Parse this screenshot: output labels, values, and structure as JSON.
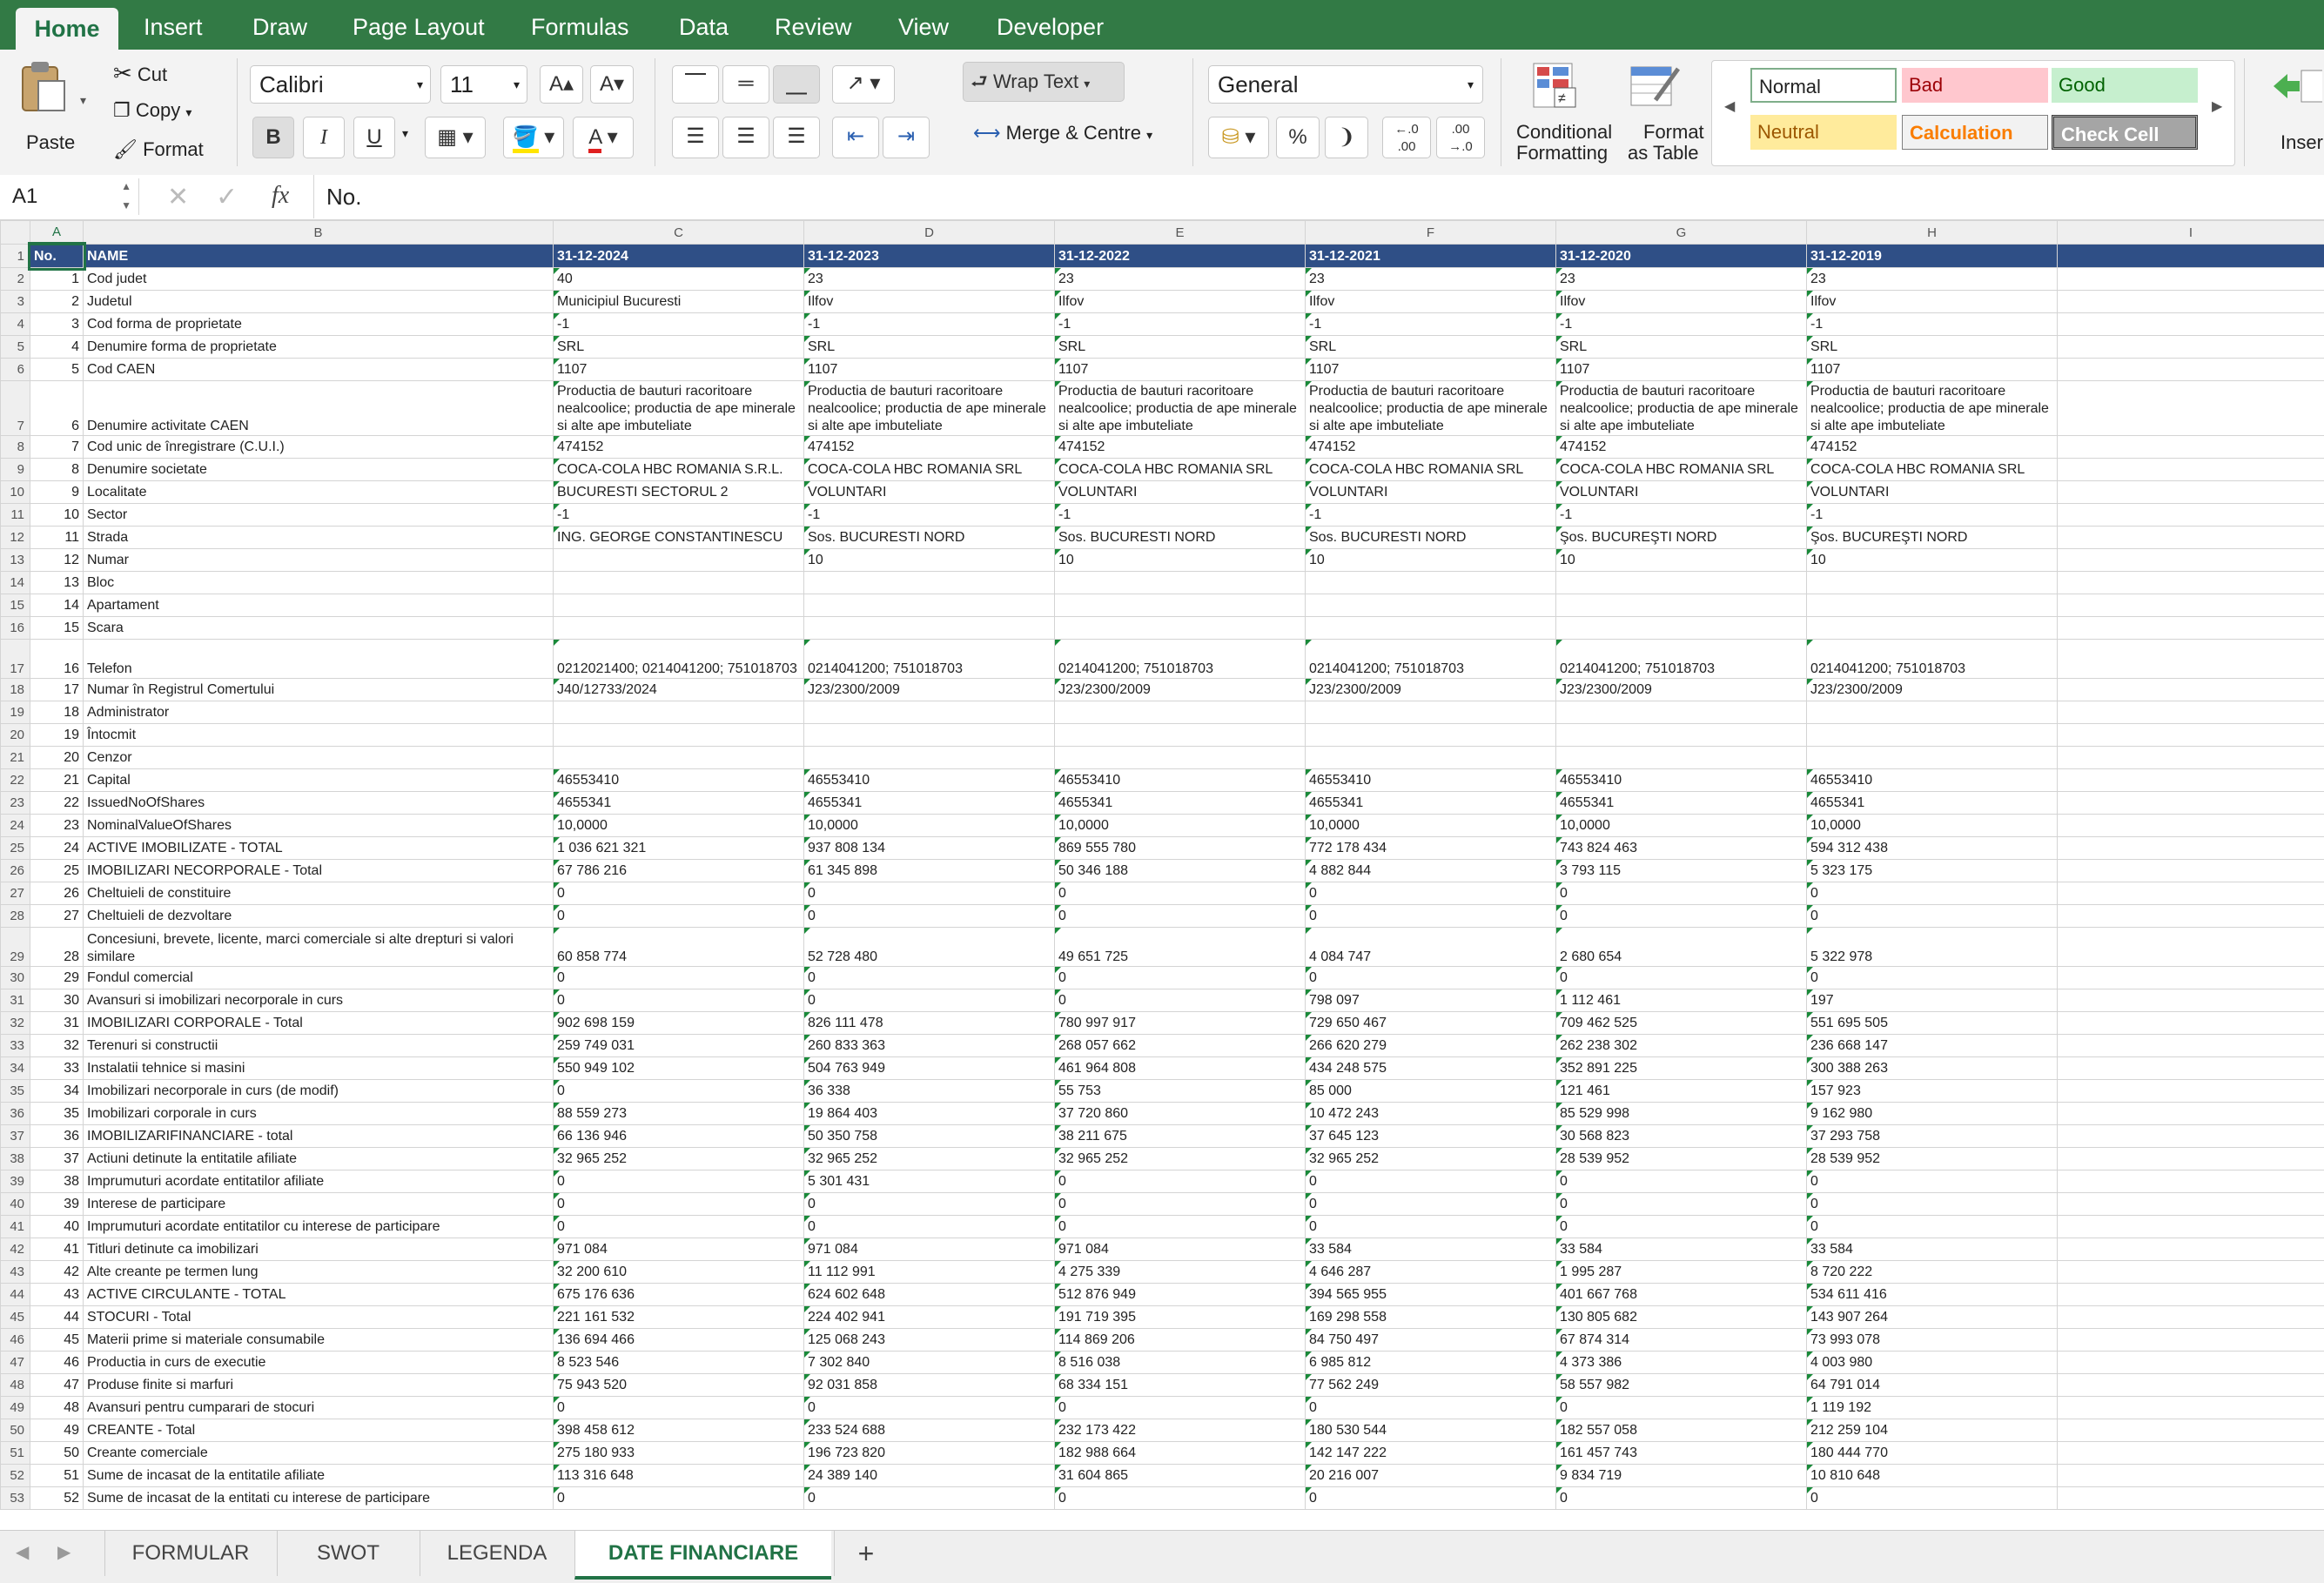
{
  "menu": {
    "tabs": [
      "Home",
      "Insert",
      "Draw",
      "Page Layout",
      "Formulas",
      "Data",
      "Review",
      "View",
      "Developer"
    ]
  },
  "ribbon": {
    "paste": "Paste",
    "cut": "Cut",
    "copy": "Copy",
    "format": "Format",
    "font_name": "Calibri",
    "font_size": "11",
    "bold": "B",
    "italic": "I",
    "underline": "U",
    "wrap_text": "Wrap Text",
    "merge": "Merge & Centre",
    "number_format": "General",
    "percent": "%",
    "cond_format_1": "Conditional",
    "cond_format_2": "Formatting",
    "fmt_table_1": "Format",
    "fmt_table_2": "as Table",
    "styles": {
      "normal": "Normal",
      "bad": "Bad",
      "good": "Good",
      "neutral": "Neutral",
      "calculation": "Calculation",
      "check_cell": "Check Cell"
    },
    "insert": "Inser"
  },
  "formula_bar": {
    "cell_ref": "A1",
    "fx": "fx",
    "value": "No."
  },
  "columns": [
    "A",
    "B",
    "C",
    "D",
    "E",
    "F",
    "G",
    "H",
    "I"
  ],
  "sheet_tabs": [
    "FORMULAR",
    "SWOT",
    "LEGENDA",
    "DATE FINANCIARE"
  ],
  "add_sheet": "+",
  "rows": [
    {
      "n": "1",
      "a": "No.",
      "b": "NAME",
      "v": [
        "31-12-2024",
        "31-12-2023",
        "31-12-2022",
        "31-12-2021",
        "31-12-2020",
        "31-12-2019"
      ]
    },
    {
      "n": "2",
      "a": "1",
      "b": "Cod judet",
      "v": [
        "40",
        "23",
        "23",
        "23",
        "23",
        "23"
      ]
    },
    {
      "n": "3",
      "a": "2",
      "b": "Judetul",
      "v": [
        "Municipiul Bucuresti",
        "Ilfov",
        "Ilfov",
        "Ilfov",
        "Ilfov",
        "Ilfov"
      ]
    },
    {
      "n": "4",
      "a": "3",
      "b": "Cod forma de proprietate",
      "v": [
        "-1",
        "-1",
        "-1",
        "-1",
        "-1",
        "-1"
      ]
    },
    {
      "n": "5",
      "a": "4",
      "b": "Denumire forma de proprietate",
      "v": [
        "SRL",
        "SRL",
        "SRL",
        "SRL",
        "SRL",
        "SRL"
      ]
    },
    {
      "n": "6",
      "a": "5",
      "b": "Cod CAEN",
      "v": [
        "1107",
        "1107",
        "1107",
        "1107",
        "1107",
        "1107"
      ]
    },
    {
      "n": "7",
      "a": "6",
      "b": "Denumire activitate CAEN",
      "v": [
        "Productia de bauturi racoritoare nealcoolice; productia de ape minerale si alte ape imbuteliate",
        "Productia de bauturi racoritoare nealcoolice; productia de ape minerale si alte ape imbuteliate",
        "Productia de bauturi racoritoare nealcoolice; productia de ape minerale si alte ape imbuteliate",
        "Productia de bauturi racoritoare nealcoolice; productia de ape minerale si alte ape imbuteliate",
        "Productia de bauturi racoritoare nealcoolice; productia de ape minerale si alte ape imbuteliate",
        "Productia de bauturi racoritoare nealcoolice; productia de ape minerale si alte ape imbuteliate"
      ]
    },
    {
      "n": "8",
      "a": "7",
      "b": "Cod unic de înregistrare (C.U.I.)",
      "v": [
        "474152",
        "474152",
        "474152",
        "474152",
        "474152",
        "474152"
      ]
    },
    {
      "n": "9",
      "a": "8",
      "b": "Denumire societate",
      "v": [
        "COCA-COLA HBC ROMANIA S.R.L.",
        "COCA-COLA HBC ROMANIA SRL",
        "COCA-COLA HBC ROMANIA SRL",
        "COCA-COLA HBC ROMANIA SRL",
        "COCA-COLA HBC ROMANIA SRL",
        "COCA-COLA HBC ROMANIA SRL"
      ]
    },
    {
      "n": "10",
      "a": "9",
      "b": "Localitate",
      "v": [
        "BUCURESTI SECTORUL 2",
        "VOLUNTARI",
        "VOLUNTARI",
        "VOLUNTARI",
        "VOLUNTARI",
        "VOLUNTARI"
      ]
    },
    {
      "n": "11",
      "a": "10",
      "b": "Sector",
      "v": [
        "-1",
        "-1",
        "-1",
        "-1",
        "-1",
        "-1"
      ]
    },
    {
      "n": "12",
      "a": "11",
      "b": "Strada",
      "v": [
        "ING. GEORGE CONSTANTINESCU",
        "Sos. BUCURESTI NORD",
        "Sos. BUCURESTI NORD",
        "Sos. BUCURESTI NORD",
        "Şos. BUCUREŞTI NORD",
        "Şos. BUCUREŞTI NORD"
      ]
    },
    {
      "n": "13",
      "a": "12",
      "b": "Numar",
      "v": [
        "",
        "10",
        "10",
        "10",
        "10",
        "10"
      ]
    },
    {
      "n": "14",
      "a": "13",
      "b": "Bloc",
      "v": [
        "",
        "",
        "",
        "",
        "",
        ""
      ]
    },
    {
      "n": "15",
      "a": "14",
      "b": "Apartament",
      "v": [
        "",
        "",
        "",
        "",
        "",
        ""
      ]
    },
    {
      "n": "16",
      "a": "15",
      "b": "Scara",
      "v": [
        "",
        "",
        "",
        "",
        "",
        ""
      ]
    },
    {
      "n": "17",
      "a": "16",
      "b": "Telefon",
      "v": [
        "0212021400; 0214041200; 751018703",
        "0214041200; 751018703",
        "0214041200; 751018703",
        "0214041200; 751018703",
        "0214041200; 751018703",
        "0214041200; 751018703"
      ]
    },
    {
      "n": "18",
      "a": "17",
      "b": "Numar în Registrul Comertului",
      "v": [
        "J40/12733/2024",
        "J23/2300/2009",
        "J23/2300/2009",
        "J23/2300/2009",
        "J23/2300/2009",
        "J23/2300/2009"
      ]
    },
    {
      "n": "19",
      "a": "18",
      "b": "Administrator",
      "v": [
        "",
        "",
        "",
        "",
        "",
        ""
      ]
    },
    {
      "n": "20",
      "a": "19",
      "b": "Întocmit",
      "v": [
        "",
        "",
        "",
        "",
        "",
        ""
      ]
    },
    {
      "n": "21",
      "a": "20",
      "b": "Cenzor",
      "v": [
        "",
        "",
        "",
        "",
        "",
        ""
      ]
    },
    {
      "n": "22",
      "a": "21",
      "b": "Capital",
      "v": [
        "46553410",
        "46553410",
        "46553410",
        "46553410",
        "46553410",
        "46553410"
      ]
    },
    {
      "n": "23",
      "a": "22",
      "b": "IssuedNoOfShares",
      "v": [
        "4655341",
        "4655341",
        "4655341",
        "4655341",
        "4655341",
        "4655341"
      ]
    },
    {
      "n": "24",
      "a": "23",
      "b": "NominalValueOfShares",
      "v": [
        "10,0000",
        "10,0000",
        "10,0000",
        "10,0000",
        "10,0000",
        "10,0000"
      ]
    },
    {
      "n": "25",
      "a": "24",
      "b": "ACTIVE IMOBILIZATE - TOTAL",
      "v": [
        "1 036 621 321",
        "937 808 134",
        "869 555 780",
        "772 178 434",
        "743 824 463",
        "594 312 438"
      ]
    },
    {
      "n": "26",
      "a": "25",
      "b": "IMOBILIZARI NECORPORALE - Total",
      "v": [
        "67 786 216",
        "61 345 898",
        "50 346 188",
        "4 882 844",
        "3 793 115",
        "5 323 175"
      ]
    },
    {
      "n": "27",
      "a": "26",
      "b": "Cheltuieli de constituire",
      "v": [
        "0",
        "0",
        "0",
        "0",
        "0",
        "0"
      ]
    },
    {
      "n": "28",
      "a": "27",
      "b": "Cheltuieli de dezvoltare",
      "v": [
        "0",
        "0",
        "0",
        "0",
        "0",
        "0"
      ]
    },
    {
      "n": "29",
      "a": "28",
      "b": "Concesiuni, brevete, licente, marci comerciale si alte drepturi si valori similare",
      "v": [
        "60 858 774",
        "52 728 480",
        "49 651 725",
        "4 084 747",
        "2 680 654",
        "5 322 978"
      ]
    },
    {
      "n": "30",
      "a": "29",
      "b": "Fondul comercial",
      "v": [
        "0",
        "0",
        "0",
        "0",
        "0",
        "0"
      ]
    },
    {
      "n": "31",
      "a": "30",
      "b": "Avansuri si imobilizari necorporale in curs",
      "v": [
        "0",
        "0",
        "0",
        "798 097",
        "1 112 461",
        "197"
      ]
    },
    {
      "n": "32",
      "a": "31",
      "b": "IMOBILIZARI CORPORALE - Total",
      "v": [
        "902 698 159",
        "826 111 478",
        "780 997 917",
        "729 650 467",
        "709 462 525",
        "551 695 505"
      ]
    },
    {
      "n": "33",
      "a": "32",
      "b": "Terenuri si constructii",
      "v": [
        "259 749 031",
        "260 833 363",
        "268 057 662",
        "266 620 279",
        "262 238 302",
        "236 668 147"
      ]
    },
    {
      "n": "34",
      "a": "33",
      "b": "Instalatii tehnice si masini",
      "v": [
        "550 949 102",
        "504 763 949",
        "461 964 808",
        "434 248 575",
        "352 891 225",
        "300 388 263"
      ]
    },
    {
      "n": "35",
      "a": "34",
      "b": "Imobilizari necorporale in curs (de modif)",
      "v": [
        "0",
        "36 338",
        "55 753",
        "85 000",
        "121 461",
        "157 923"
      ]
    },
    {
      "n": "36",
      "a": "35",
      "b": "Imobilizari corporale in curs",
      "v": [
        "88 559 273",
        "19 864 403",
        "37 720 860",
        "10 472 243",
        "85 529 998",
        "9 162 980"
      ]
    },
    {
      "n": "37",
      "a": "36",
      "b": "IMOBILIZARIFINANCIARE - total",
      "v": [
        "66 136 946",
        "50 350 758",
        "38 211 675",
        "37 645 123",
        "30 568 823",
        "37 293 758"
      ]
    },
    {
      "n": "38",
      "a": "37",
      "b": "Actiuni detinute la entitatile afiliate",
      "v": [
        "32 965 252",
        "32 965 252",
        "32 965 252",
        "32 965 252",
        "28 539 952",
        "28 539 952"
      ]
    },
    {
      "n": "39",
      "a": "38",
      "b": "Imprumuturi acordate entitatilor afiliate",
      "v": [
        "0",
        "5 301 431",
        "0",
        "0",
        "0",
        "0"
      ]
    },
    {
      "n": "40",
      "a": "39",
      "b": "Interese de participare",
      "v": [
        "0",
        "0",
        "0",
        "0",
        "0",
        "0"
      ]
    },
    {
      "n": "41",
      "a": "40",
      "b": "Imprumuturi acordate entitatilor cu interese de participare",
      "v": [
        "0",
        "0",
        "0",
        "0",
        "0",
        "0"
      ]
    },
    {
      "n": "42",
      "a": "41",
      "b": "Titluri detinute ca imobilizari",
      "v": [
        "971 084",
        "971 084",
        "971 084",
        "33 584",
        "33 584",
        "33 584"
      ]
    },
    {
      "n": "43",
      "a": "42",
      "b": "Alte creante pe termen lung",
      "v": [
        "32 200 610",
        "11 112 991",
        "4 275 339",
        "4 646 287",
        "1 995 287",
        "8 720 222"
      ]
    },
    {
      "n": "44",
      "a": "43",
      "b": "ACTIVE CIRCULANTE - TOTAL",
      "v": [
        "675 176 636",
        "624 602 648",
        "512 876 949",
        "394 565 955",
        "401 667 768",
        "534 611 416"
      ]
    },
    {
      "n": "45",
      "a": "44",
      "b": "STOCURI - Total",
      "v": [
        "221 161 532",
        "224 402 941",
        "191 719 395",
        "169 298 558",
        "130 805 682",
        "143 907 264"
      ]
    },
    {
      "n": "46",
      "a": "45",
      "b": "Materii prime si materiale consumabile",
      "v": [
        "136 694 466",
        "125 068 243",
        "114 869 206",
        "84 750 497",
        "67 874 314",
        "73 993 078"
      ]
    },
    {
      "n": "47",
      "a": "46",
      "b": "Productia in curs de executie",
      "v": [
        "8 523 546",
        "7 302 840",
        "8 516 038",
        "6 985 812",
        "4 373 386",
        "4 003 980"
      ]
    },
    {
      "n": "48",
      "a": "47",
      "b": "Produse finite si marfuri",
      "v": [
        "75 943 520",
        "92 031 858",
        "68 334 151",
        "77 562 249",
        "58 557 982",
        "64 791 014"
      ]
    },
    {
      "n": "49",
      "a": "48",
      "b": "Avansuri pentru cumparari de stocuri",
      "v": [
        "0",
        "0",
        "0",
        "0",
        "0",
        "1 119 192"
      ]
    },
    {
      "n": "50",
      "a": "49",
      "b": "CREANTE - Total",
      "v": [
        "398 458 612",
        "233 524 688",
        "232 173 422",
        "180 530 544",
        "182 557 058",
        "212 259 104"
      ]
    },
    {
      "n": "51",
      "a": "50",
      "b": "Creante comerciale",
      "v": [
        "275 180 933",
        "196 723 820",
        "182 988 664",
        "142 147 222",
        "161 457 743",
        "180 444 770"
      ]
    },
    {
      "n": "52",
      "a": "51",
      "b": "Sume de incasat de la entitatile afiliate",
      "v": [
        "113 316 648",
        "24 389 140",
        "31 604 865",
        "20 216 007",
        "9 834 719",
        "10 810 648"
      ]
    },
    {
      "n": "53",
      "a": "52",
      "b": "Sume de incasat de la entitati cu interese de participare",
      "v": [
        "0",
        "0",
        "0",
        "0",
        "0",
        "0"
      ]
    }
  ]
}
